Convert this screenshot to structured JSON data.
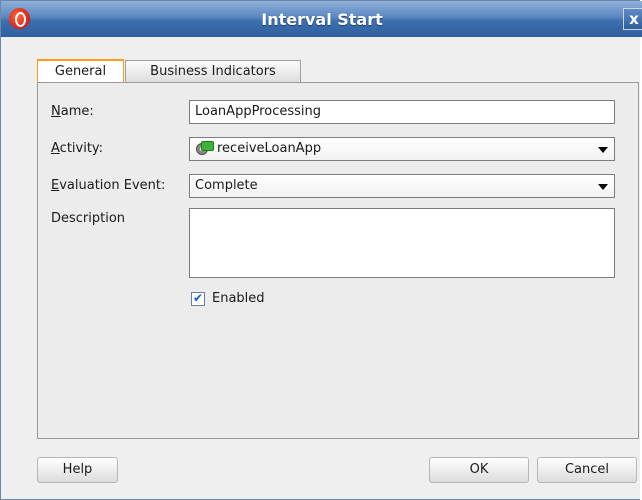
{
  "window": {
    "title": "Interval Start",
    "close_label": "x"
  },
  "tabs": [
    {
      "label": "General",
      "active": true
    },
    {
      "label": "Business Indicators",
      "active": false
    }
  ],
  "form": {
    "name_label_mnemonic": "N",
    "name_label_rest": "ame:",
    "name_value": "LoanAppProcessing",
    "activity_label_mnemonic": "A",
    "activity_label_rest": "ctivity:",
    "activity_value": "receiveLoanApp",
    "activity_icon": "receive-activity-icon",
    "evaluation_label_mnemonic": "E",
    "evaluation_label_rest": "valuation Event:",
    "evaluation_value": "Complete",
    "description_label": "Description",
    "description_value": "",
    "enabled_label": "Enabled",
    "enabled_checked": true
  },
  "buttons": {
    "help": "Help",
    "ok": "OK",
    "cancel": "Cancel"
  },
  "colors": {
    "accent_tab": "#ff9c1a",
    "titlebar": "#3e6faf",
    "checkmark": "#1b59c6"
  }
}
